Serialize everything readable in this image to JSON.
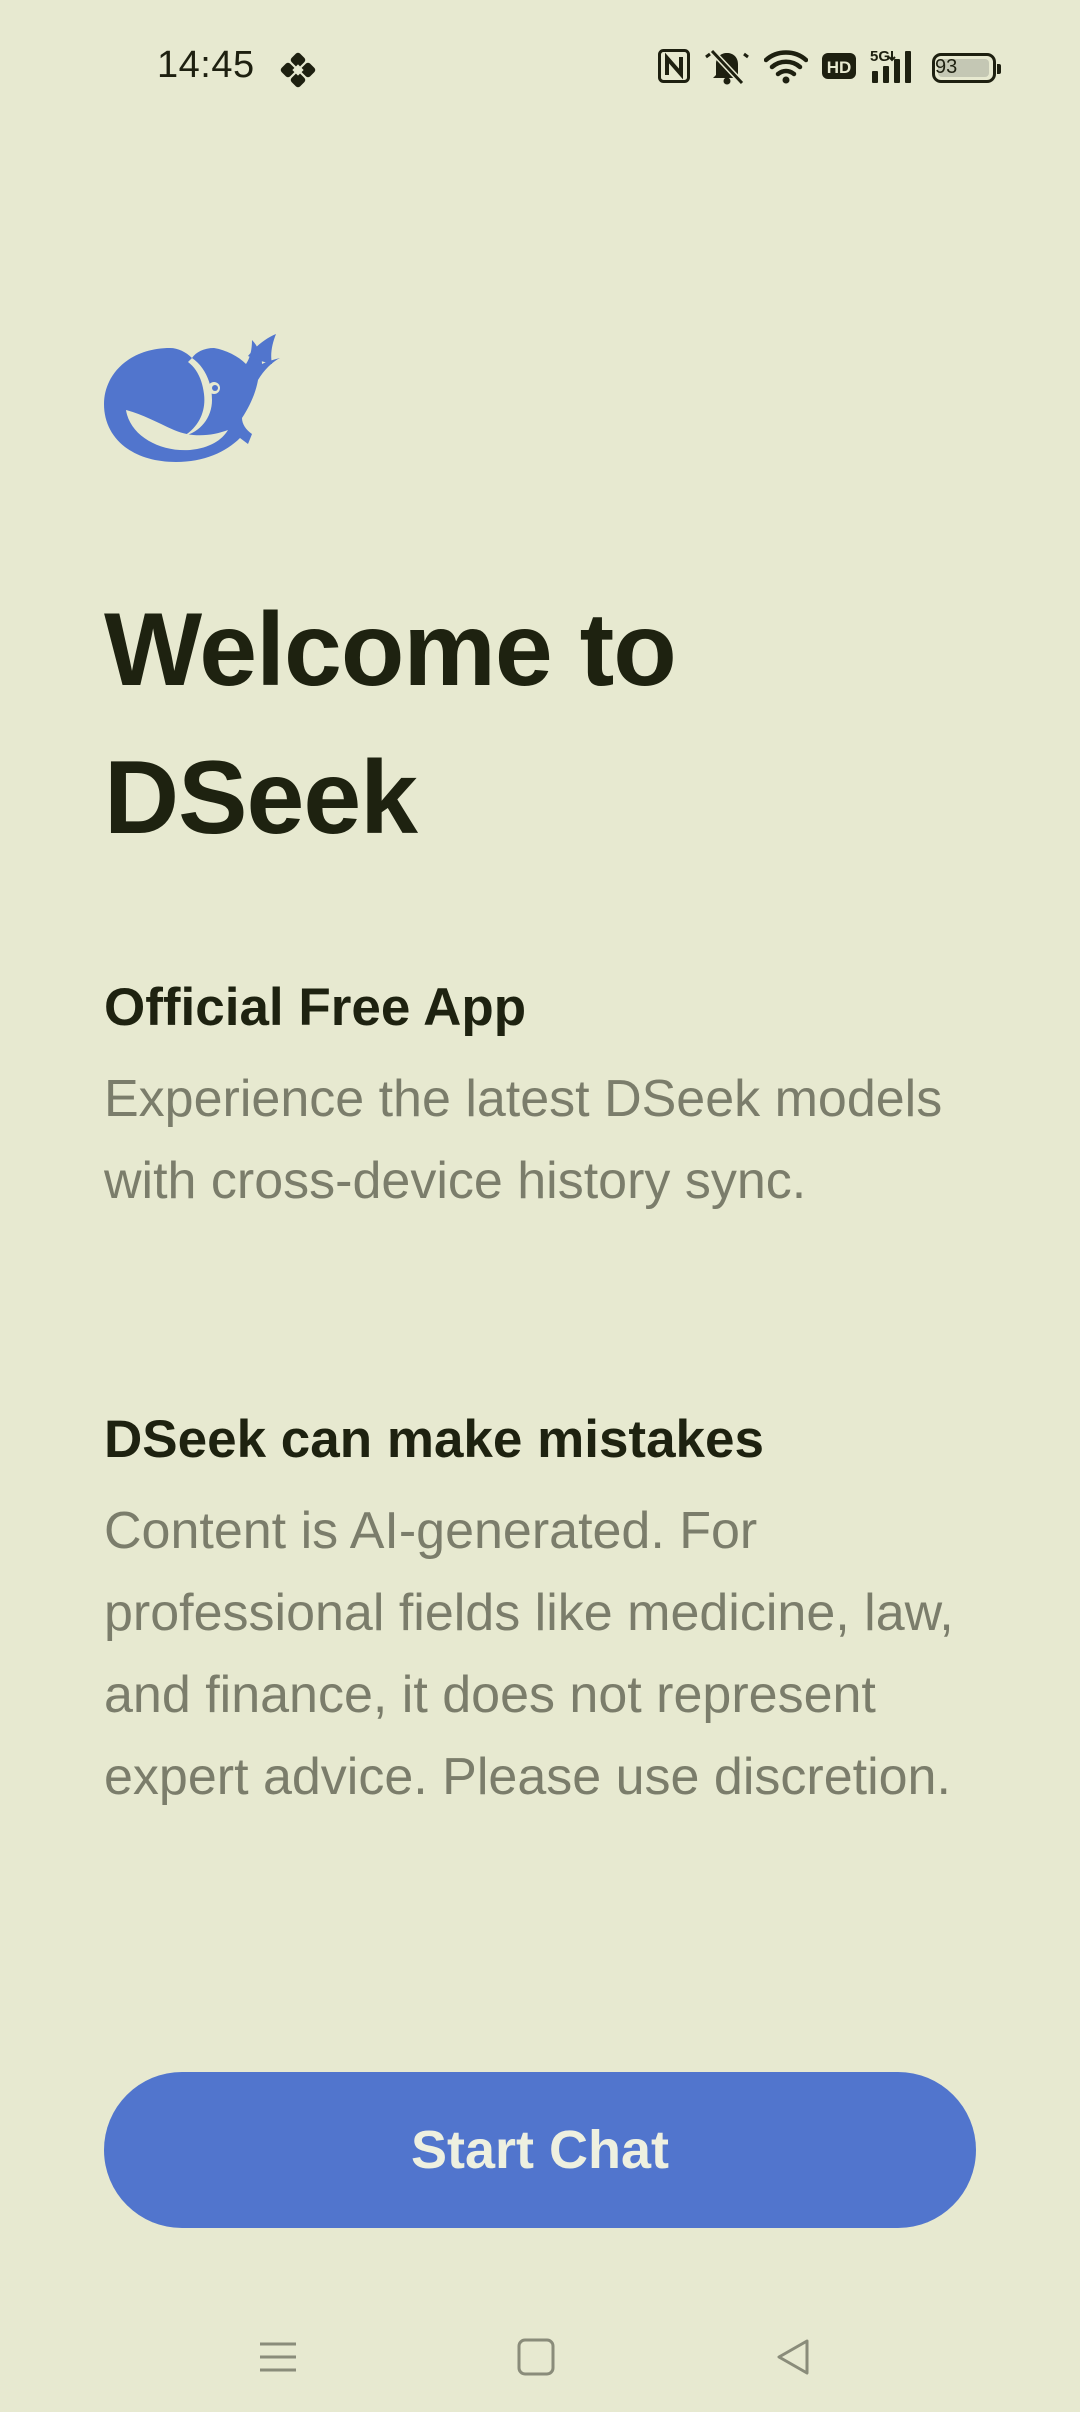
{
  "status_bar": {
    "time": "14:45",
    "battery_level": "93",
    "icons": [
      "app-notification-icon",
      "nfc-icon",
      "bell-muted-icon",
      "wifi-icon",
      "hd-icon",
      "signal-5g-icon",
      "battery-icon"
    ]
  },
  "welcome": {
    "title_line1": "Welcome to",
    "title_line2": "DSeek",
    "logo_icon": "whale-logo-icon"
  },
  "sections": [
    {
      "heading": "Official Free App",
      "body": "Experience the latest DSeek models with cross-device history sync."
    },
    {
      "heading": "DSeek can make mistakes",
      "body": "Content is AI-generated. For professional fields like medicine, law, and finance, it does not represent expert advice. Please use discretion."
    }
  ],
  "actions": {
    "start_chat_label": "Start Chat"
  },
  "nav_bar": {
    "icons": [
      "menu-icon",
      "home-icon",
      "back-icon"
    ]
  },
  "colors": {
    "background": "#e7e9d0",
    "accent": "#5175cd",
    "heading_text": "#1e2210",
    "body_text": "#7b7d6b"
  }
}
